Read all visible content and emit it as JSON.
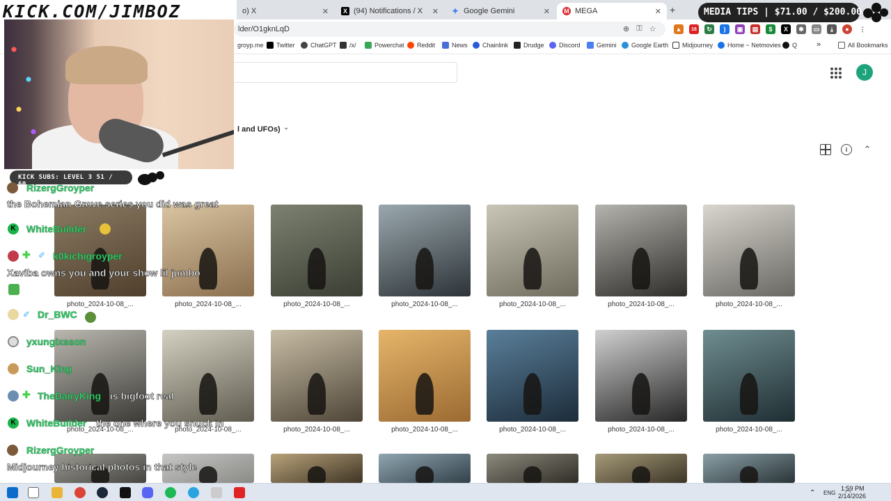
{
  "browser": {
    "tabs": [
      {
        "label": "o) X",
        "favicon": "x-icon"
      },
      {
        "label": "(94) Notifications / X",
        "favicon": "x-icon"
      },
      {
        "label": "Google Gemini",
        "favicon": "gemini-icon"
      },
      {
        "label": "MEGA",
        "favicon": "mega-icon"
      }
    ],
    "new_tab": "+",
    "url": "lder/O1gknLqD",
    "ext_badge": "16",
    "bookmarks": [
      "groyp.me",
      "Twitter",
      "ChatGPT",
      "/x/",
      "Powerchat",
      "Reddit",
      "News",
      "Chainlink",
      "Drudge",
      "Discord",
      "Gemini",
      "Google Earth",
      "Midjourney",
      "Home ~ Netmovies",
      "Q"
    ],
    "bookmarks_more": "»",
    "all_bookmarks": "All Bookmarks"
  },
  "page": {
    "avatar_letter": "J",
    "folder_title": "l and UFOs)",
    "thumbnails": [
      {
        "caption": "photo_2024-10-08_...",
        "colors": [
          "#8b7a63",
          "#4f3f2c"
        ]
      },
      {
        "caption": "photo_2024-10-08_...",
        "colors": [
          "#d9c4a2",
          "#8b6f4e"
        ]
      },
      {
        "caption": "photo_2024-10-08_...",
        "colors": [
          "#7d8170",
          "#3b3f34"
        ]
      },
      {
        "caption": "photo_2024-10-08_...",
        "colors": [
          "#9aa8ad",
          "#2d3338"
        ]
      },
      {
        "caption": "photo_2024-10-08_...",
        "colors": [
          "#c9c6b7",
          "#6f6c5e"
        ]
      },
      {
        "caption": "photo_2024-10-08_...",
        "colors": [
          "#b5b3ad",
          "#2e2d2a"
        ]
      },
      {
        "caption": "photo_2024-10-08_...",
        "colors": [
          "#d8d6cf",
          "#6a6862"
        ]
      },
      {
        "caption": "photo_2024-10-08_...",
        "colors": [
          "#b9b7ae",
          "#3b3a36"
        ]
      },
      {
        "caption": "photo_2024-10-08_...",
        "colors": [
          "#d4d0c2",
          "#5f5b4e"
        ]
      },
      {
        "caption": "photo_2024-10-08_...",
        "colors": [
          "#c7bda5",
          "#4e4538"
        ]
      },
      {
        "caption": "photo_2024-10-08_...",
        "colors": [
          "#e6b56a",
          "#9a6a32"
        ]
      },
      {
        "caption": "photo_2024-10-08_...",
        "colors": [
          "#5a7f9a",
          "#1c2c3a"
        ]
      },
      {
        "caption": "photo_2024-10-08_...",
        "colors": [
          "#cfd0cf",
          "#262626"
        ]
      },
      {
        "caption": "photo_2024-10-08_...",
        "colors": [
          "#6f8d8f",
          "#1f2e33"
        ]
      },
      {
        "caption": "",
        "colors": [
          "#9b9a92",
          "#454440"
        ]
      },
      {
        "caption": "",
        "colors": [
          "#c6c6c4",
          "#8a8a87"
        ]
      },
      {
        "caption": "",
        "colors": [
          "#b8a27a",
          "#3f3525"
        ]
      },
      {
        "caption": "",
        "colors": [
          "#8fa5b0",
          "#324049"
        ]
      },
      {
        "caption": "",
        "colors": [
          "#8c8a7d",
          "#2f2d26"
        ]
      },
      {
        "caption": "",
        "colors": [
          "#a59a78",
          "#3c3526"
        ]
      },
      {
        "caption": "",
        "colors": [
          "#8aa0a6",
          "#2a3438"
        ]
      }
    ]
  },
  "overlay": {
    "logo": "KICK.COM/JIMBOZ",
    "subs_badge": "KICK SUBS: LEVEL 3 51 / 60",
    "media_tips": "MEDIA TIPS | $71.00 / $200.00",
    "chat": [
      {
        "name": "RizergGroyper",
        "msg": ""
      },
      {
        "name": "",
        "msg": "the Bohemian Grove series you did was great"
      },
      {
        "name": "WhiteBuilder",
        "msg": ""
      },
      {
        "name": "k0kichigroyper",
        "msg": ""
      },
      {
        "name": "",
        "msg": "Xaviba owns you and your show lil jumbo"
      },
      {
        "name": "Dr_BWC",
        "msg": ""
      },
      {
        "name": "yxungixsson",
        "msg": ""
      },
      {
        "name": "Sun_King",
        "msg": ""
      },
      {
        "name": "TheDairyKing",
        "msg": "is bigfoot real"
      },
      {
        "name": "WhiteBuilder",
        "msg": "the one where you snuck in"
      },
      {
        "name": "RizergGroyper",
        "msg": ""
      },
      {
        "name": "",
        "msg": "Midjourney historical photos in that style"
      }
    ]
  },
  "taskbar": {
    "lang": "ENG",
    "time": "1:59 PM",
    "date": "2/14/2026"
  }
}
